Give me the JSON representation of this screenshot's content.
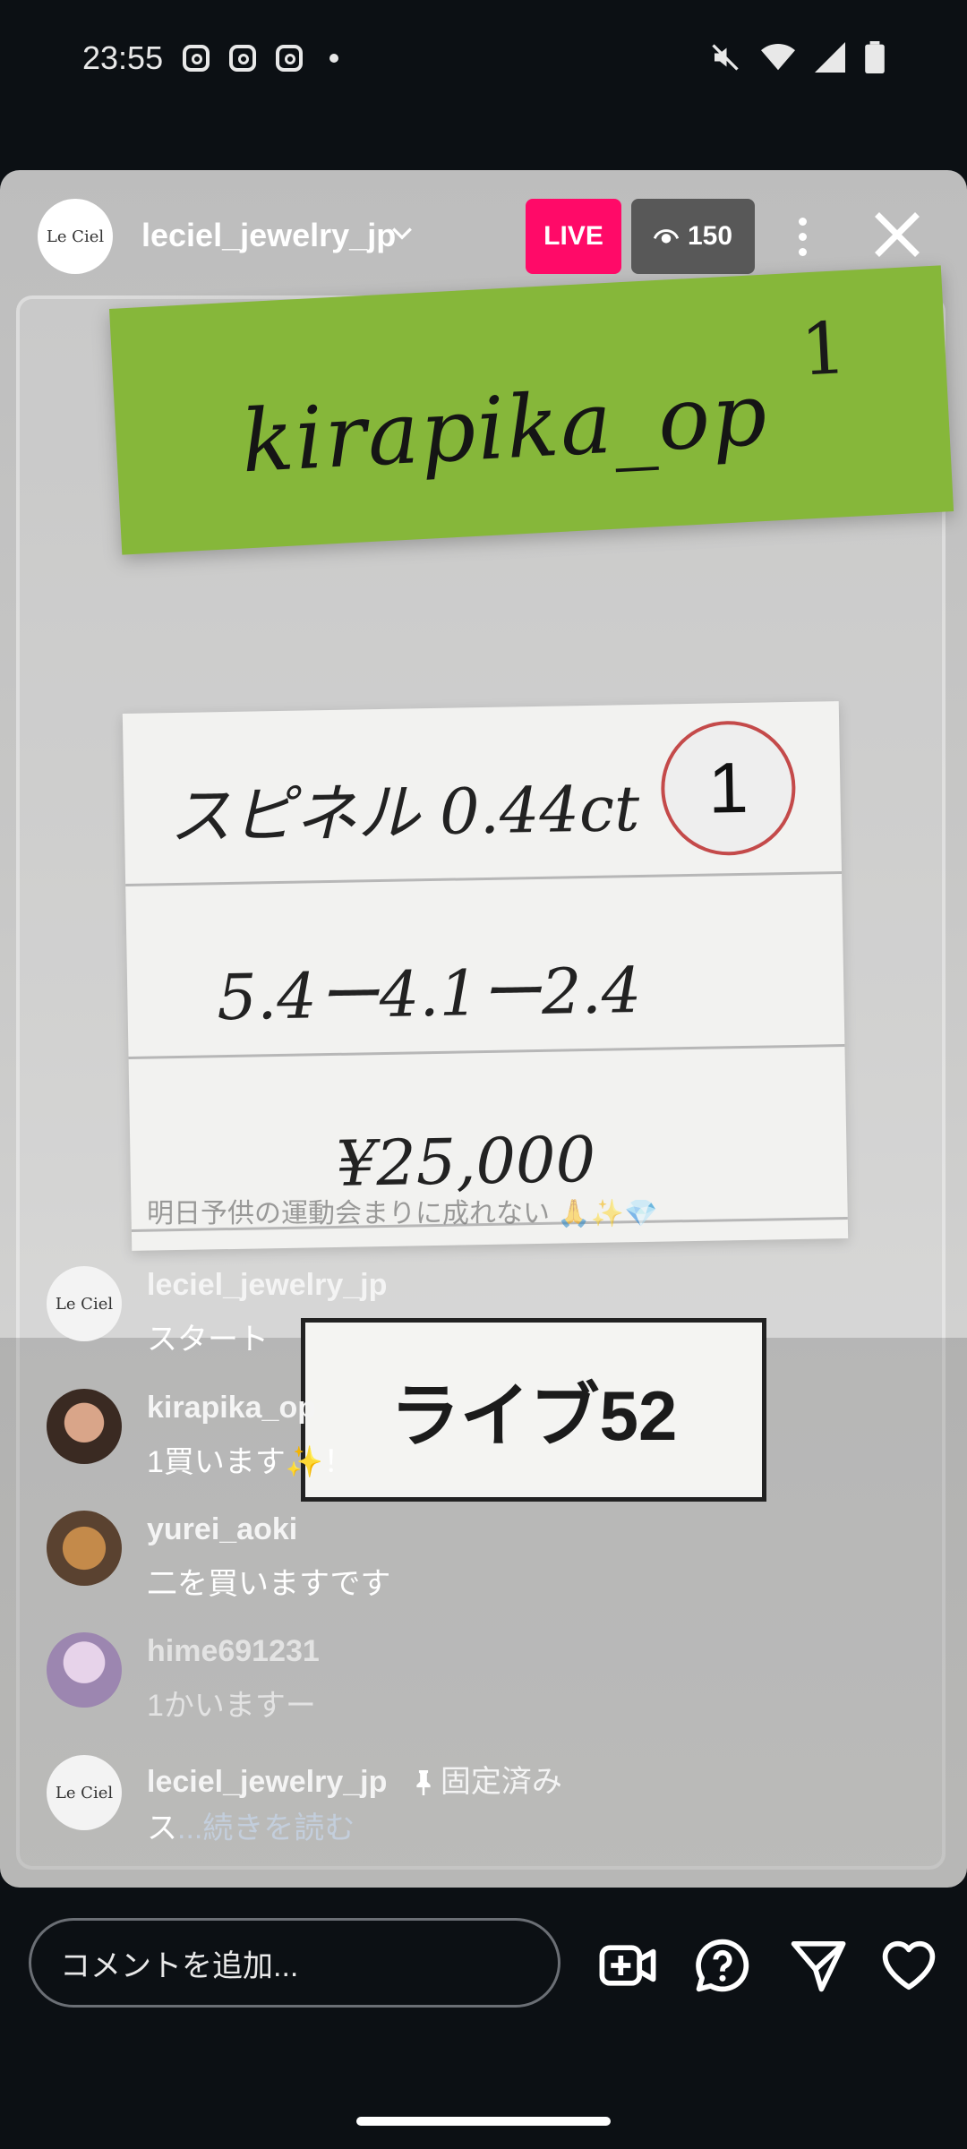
{
  "status_bar": {
    "time": "23:55"
  },
  "live": {
    "host_username": "leciel_jewelry_jp",
    "host_avatar_text": "Le Ciel",
    "live_label": "LIVE",
    "viewer_count": "150"
  },
  "video_scene": {
    "sticky_number": "1",
    "sticky_name": "kirapika_op",
    "card_row1": "スピネル 0.44ct",
    "card_badge": "1",
    "card_row2": "5.4ー4.1ー2.4",
    "card_row3": "¥25,000",
    "stream_label": "ライブ52"
  },
  "comments": [
    {
      "username": "leciel_jewelry_jp",
      "text": "スタート",
      "avatar_text": "Le Ciel"
    },
    {
      "username": "kirapika_op",
      "text": "1買います✨！"
    },
    {
      "username": "yurei_aoki",
      "text": "二を買いますです"
    },
    {
      "username": "hime691231",
      "text": "1かいますー"
    },
    {
      "username": "leciel_jewelry_jp",
      "pinned_label": "固定済み",
      "text": "ス",
      "read_more": "...続きを読む",
      "avatar_text": "Le Ciel"
    }
  ],
  "faded_comment": "明日予供の運動会まりに成れない 🙏✨💎",
  "bottom_bar": {
    "comment_placeholder": "コメントを追加..."
  },
  "colors": {
    "live_badge": "#ff0a68",
    "background": "#0c1014"
  }
}
